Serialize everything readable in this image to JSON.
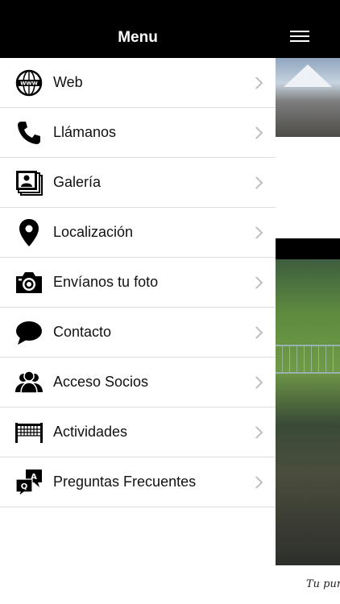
{
  "header": {
    "title": "Menu"
  },
  "menu": {
    "items": [
      {
        "label": "Web",
        "icon": "globe-icon"
      },
      {
        "label": "Llámanos",
        "icon": "phone-icon"
      },
      {
        "label": "Galería",
        "icon": "photos-icon"
      },
      {
        "label": "Localización",
        "icon": "map-pin-icon"
      },
      {
        "label": "Envíanos tu foto",
        "icon": "camera-icon"
      },
      {
        "label": "Contacto",
        "icon": "chat-bubble-icon"
      },
      {
        "label": "Acceso Socios",
        "icon": "group-icon"
      },
      {
        "label": "Actividades",
        "icon": "net-icon"
      },
      {
        "label": "Preguntas Frecuentes",
        "icon": "qa-icon"
      }
    ]
  },
  "preview": {
    "caption": "Tu pun"
  }
}
